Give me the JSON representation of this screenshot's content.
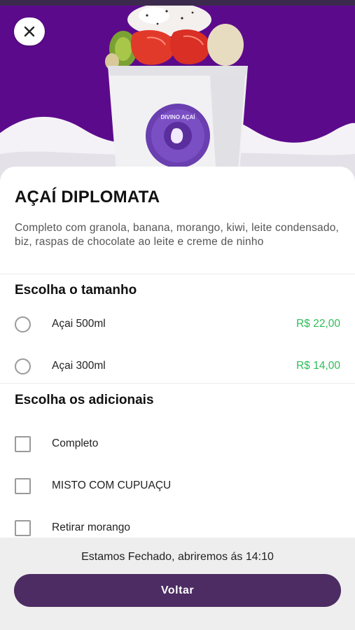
{
  "product": {
    "title": "AÇAÍ DIPLOMATA",
    "description": "Completo com granola, banana, morango, kiwi, leite condensado, biz, raspas de chocolate ao leite e creme de ninho"
  },
  "hero": {
    "image_name": "acai-cup-photo",
    "badge_text": "DIVINO AÇAÍ"
  },
  "size_section": {
    "title": "Escolha o tamanho",
    "options": [
      {
        "label": "Açai 500ml",
        "price": "R$ 22,00",
        "selected": false
      },
      {
        "label": "Açai 300ml",
        "price": "R$ 14,00",
        "selected": false
      }
    ]
  },
  "addons_section": {
    "title": "Escolha os adicionais",
    "options": [
      {
        "label": "Completo",
        "checked": false
      },
      {
        "label": "MISTO COM CUPUAÇU",
        "checked": false
      },
      {
        "label": "Retirar morango",
        "checked": false
      }
    ]
  },
  "footer": {
    "closed_message": "Estamos Fechado, abriremos ás 14:10",
    "back_label": "Voltar"
  },
  "colors": {
    "hero_bg": "#5c0a8c",
    "price_green": "#2ebd59",
    "button_bg": "#4c2c62"
  }
}
